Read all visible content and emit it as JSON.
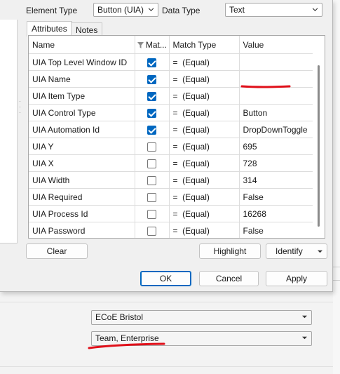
{
  "element_type": {
    "label": "Element Type",
    "value": "Button (UIA)"
  },
  "data_type": {
    "label": "Data Type",
    "value": "Text"
  },
  "tabs": [
    {
      "label": "Attributes"
    },
    {
      "label": "Notes"
    }
  ],
  "grid": {
    "headers": {
      "name": "Name",
      "match": "Mat...",
      "match_type": "Match Type",
      "value": "Value"
    },
    "rows": [
      {
        "name": "UIA Top Level Window ID",
        "match": true,
        "match_type": "=  (Equal)",
        "value": ""
      },
      {
        "name": "UIA Name",
        "match": true,
        "match_type": "=  (Equal)",
        "value": ""
      },
      {
        "name": "UIA Item Type",
        "match": true,
        "match_type": "=  (Equal)",
        "value": ""
      },
      {
        "name": "UIA Control Type",
        "match": true,
        "match_type": "=  (Equal)",
        "value": "Button"
      },
      {
        "name": "UIA Automation Id",
        "match": true,
        "match_type": "=  (Equal)",
        "value": "DropDownToggle"
      },
      {
        "name": "UIA Y",
        "match": false,
        "match_type": "=  (Equal)",
        "value": "695"
      },
      {
        "name": "UIA X",
        "match": false,
        "match_type": "=  (Equal)",
        "value": "728"
      },
      {
        "name": "UIA Width",
        "match": false,
        "match_type": "=  (Equal)",
        "value": "314"
      },
      {
        "name": "UIA Required",
        "match": false,
        "match_type": "=  (Equal)",
        "value": "False"
      },
      {
        "name": "UIA Process Id",
        "match": false,
        "match_type": "=  (Equal)",
        "value": "16268"
      },
      {
        "name": "UIA Password",
        "match": false,
        "match_type": "=  (Equal)",
        "value": "False"
      }
    ]
  },
  "buttons": {
    "clear": "Clear",
    "highlight": "Highlight",
    "identify": "Identify",
    "ok": "OK",
    "cancel": "Cancel",
    "apply": "Apply"
  },
  "background": {
    "dropdown1": "ECoE Bristol",
    "dropdown2": "Team, Enterprise"
  },
  "colors": {
    "accent": "#0067c0",
    "annotation": "#e0101a"
  }
}
